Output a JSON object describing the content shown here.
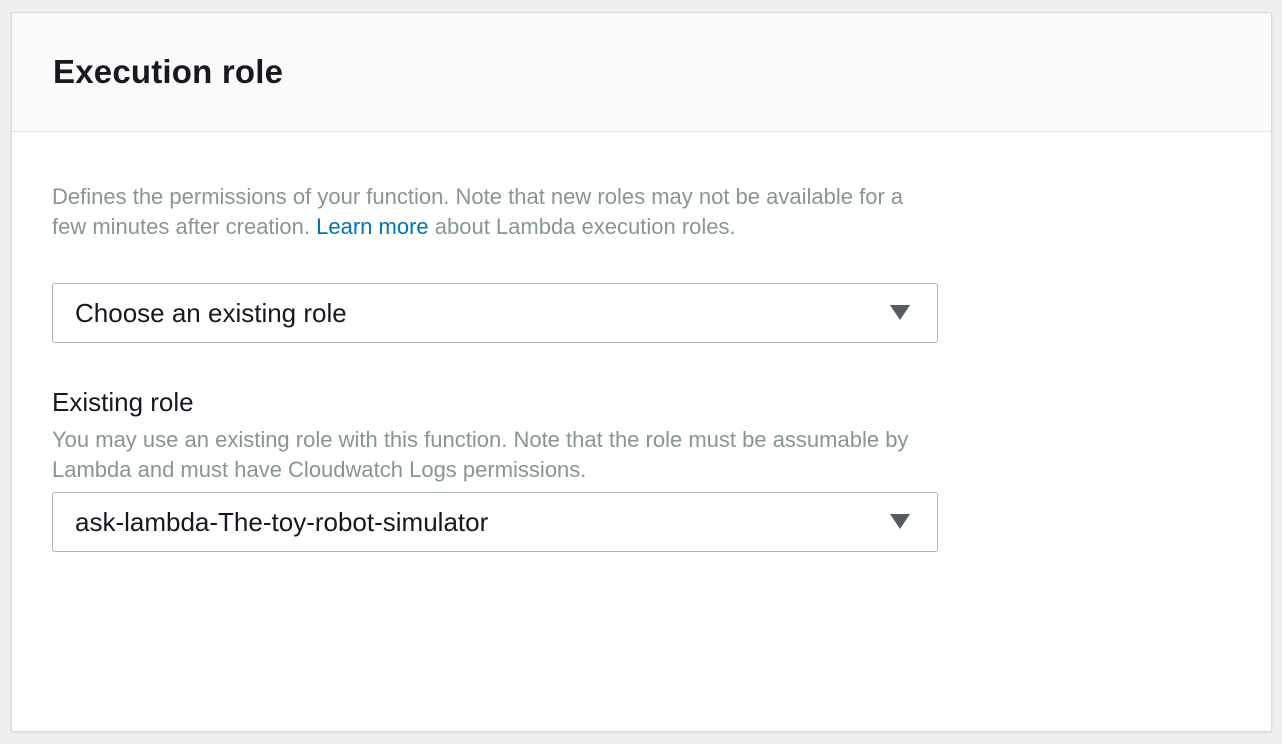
{
  "panel": {
    "title": "Execution role"
  },
  "description": {
    "text_before": "Defines the permissions of your function. Note that new roles may not be available for a few minutes after creation. ",
    "link": "Learn more",
    "text_after": " about Lambda execution roles."
  },
  "role_mode_select": {
    "value": "Choose an existing role",
    "icon": "caret-down-icon"
  },
  "existing_role": {
    "label": "Existing role",
    "hint": "You may use an existing role with this function. Note that the role must be assumable by Lambda and must have Cloudwatch Logs permissions.",
    "value": "ask-lambda-The-toy-robot-simulator",
    "icon": "caret-down-icon"
  },
  "colors": {
    "heading": "#16191f",
    "muted_text": "#879596",
    "link": "#0073bb",
    "select_border": "#aab7b8",
    "caret": "#545b64",
    "header_bg": "#fafafa"
  }
}
